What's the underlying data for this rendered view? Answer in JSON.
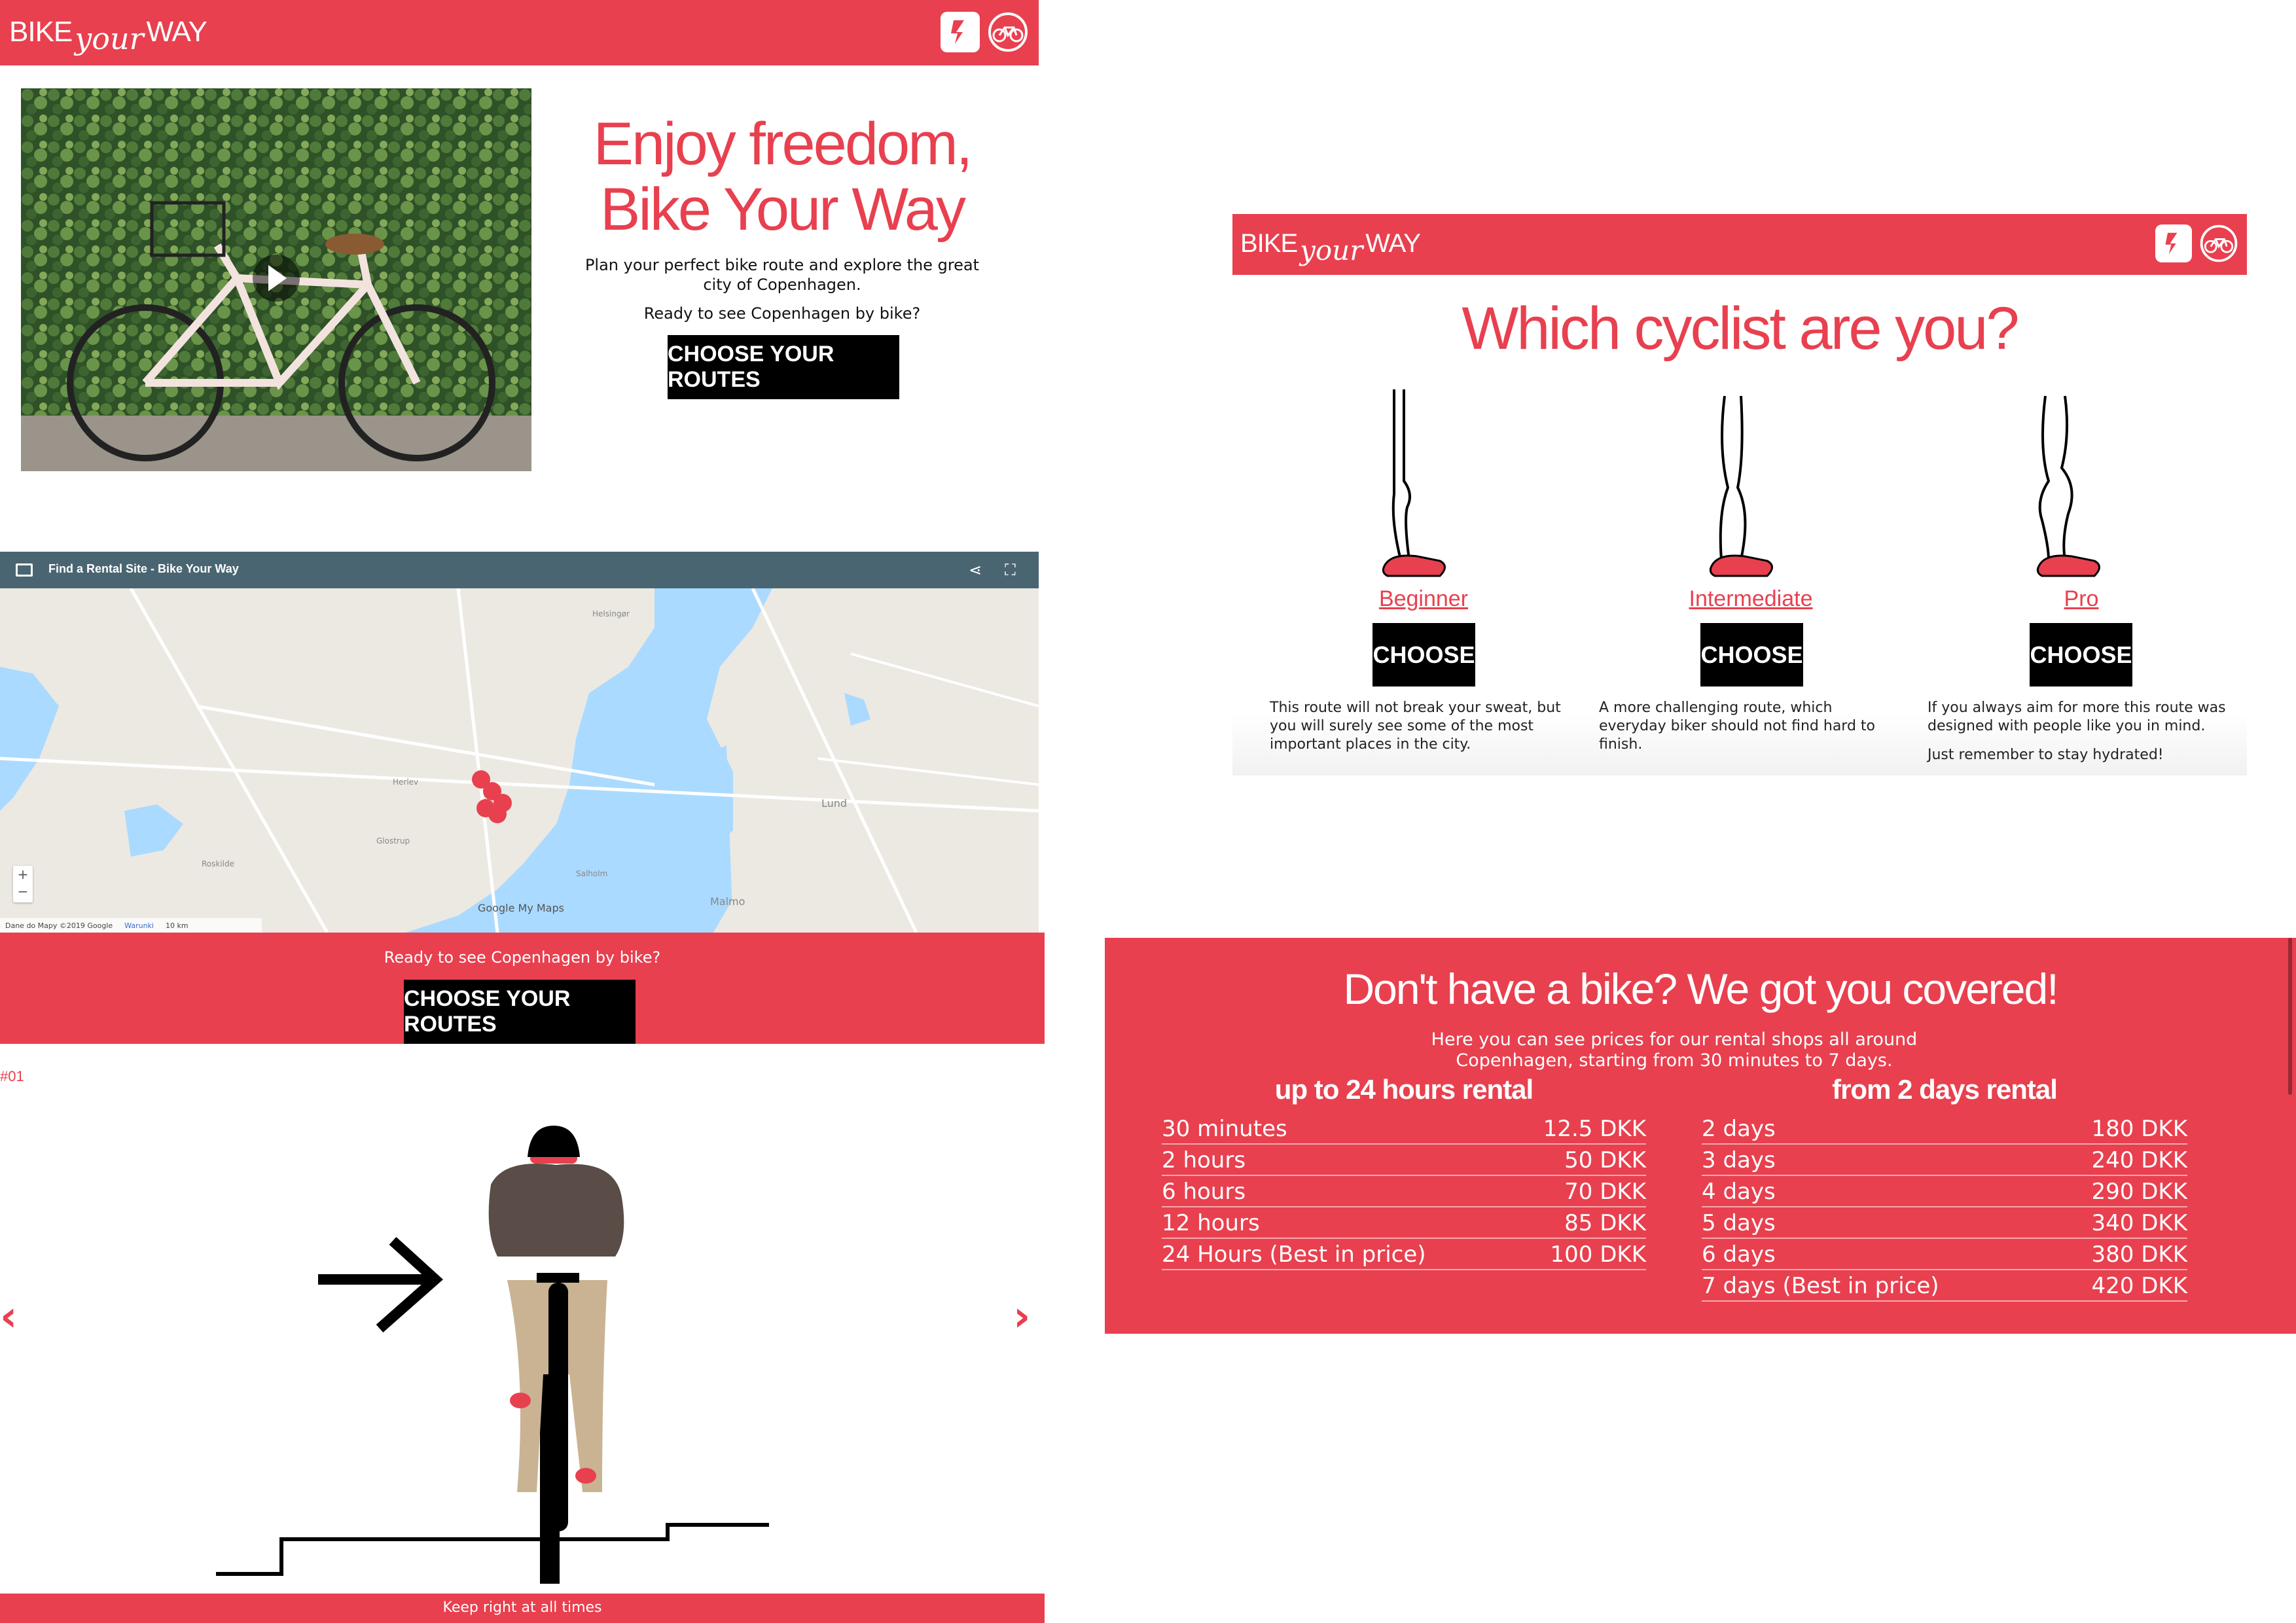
{
  "brand": {
    "word1": "BIKE",
    "script": "your",
    "word2": "WAY"
  },
  "hero": {
    "title": "Enjoy freedom, Bike Your Way",
    "subtitle": "Plan your perfect bike route and explore the great city of Copenhagen.",
    "prompt": "Ready to see Copenhagen by bike?",
    "cta": "CHOOSE YOUR ROUTES"
  },
  "map": {
    "title": "Find a Rental Site - Bike Your Way",
    "footer_credit": "Dane do Mapy ©2019 Google",
    "footer_terms": "Warunki",
    "footer_scale": "10 km",
    "brand": "Google My Maps",
    "labels": [
      "Lund",
      "Malmo",
      "Roskilde",
      "Glostrup",
      "Herlev",
      "Salholm",
      "Helsingør"
    ]
  },
  "cta_band": {
    "prompt": "Ready to see Copenhagen by bike?",
    "cta": "CHOOSE YOUR ROUTES"
  },
  "slider": {
    "index": "#01",
    "caption": "Keep right at all times",
    "prev": "‹",
    "next": "›"
  },
  "cyclist": {
    "title": "Which cyclist are you?",
    "types": [
      {
        "label": "Beginner",
        "button": "CHOOSE",
        "desc": "This route will not break your sweat, but you will surely see some of the most important places in the city.",
        "extra": ""
      },
      {
        "label": "Intermediate",
        "button": "CHOOSE",
        "desc": "A more challenging route, which everyday biker should not find hard to finish.",
        "extra": ""
      },
      {
        "label": "Pro",
        "button": "CHOOSE",
        "desc": "If you always aim for more this route was designed with people like you in mind.",
        "extra": "Just remember to stay hydrated!"
      }
    ]
  },
  "rental": {
    "title": "Don't have a bike? We got you covered!",
    "subtitle": "Here you can see prices for our rental shops all around Copenhagen, starting from 30 minutes to 7 days.",
    "short": {
      "heading": "up to 24 hours rental",
      "rows": [
        {
          "period": "30 minutes",
          "price": "12.5 DKK"
        },
        {
          "period": "2 hours",
          "price": "50 DKK"
        },
        {
          "period": "6 hours",
          "price": "70 DKK"
        },
        {
          "period": "12 hours",
          "price": "85 DKK"
        },
        {
          "period": "24 Hours (Best in price)",
          "price": "100 DKK"
        }
      ]
    },
    "long": {
      "heading": "from 2 days rental",
      "rows": [
        {
          "period": "2 days",
          "price": "180 DKK"
        },
        {
          "period": "3 days",
          "price": "240 DKK"
        },
        {
          "period": "4 days",
          "price": "290 DKK"
        },
        {
          "period": "5 days",
          "price": "340 DKK"
        },
        {
          "period": "6 days",
          "price": "380 DKK"
        },
        {
          "period": "7 days (Best in price)",
          "price": "420 DKK"
        }
      ]
    }
  },
  "colors": {
    "accent": "#e8404f",
    "map_bar": "#4a6572",
    "water": "#aadaff"
  }
}
